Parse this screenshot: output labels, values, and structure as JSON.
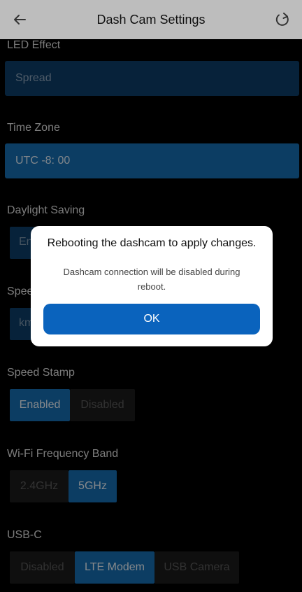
{
  "header": {
    "title": "Dash Cam Settings",
    "back_icon": "arrow-left-icon",
    "refresh_icon": "refresh-icon"
  },
  "led_effect": {
    "label": "LED Effect",
    "value": "Spread"
  },
  "time_zone": {
    "label": "Time Zone",
    "value": "UTC -8: 00"
  },
  "daylight_saving": {
    "label": "Daylight Saving",
    "partial": "En"
  },
  "speed_unit": {
    "label": "Spee",
    "partial": "km"
  },
  "speed_stamp": {
    "label": "Speed Stamp",
    "options": [
      "Enabled",
      "Disabled"
    ],
    "selected": "Enabled"
  },
  "wifi_band": {
    "label": "Wi-Fi Frequency Band",
    "options": [
      "2.4GHz",
      "5GHz"
    ],
    "selected": "5GHz"
  },
  "usb_c": {
    "label": "USB-C",
    "options": [
      "Disabled",
      "LTE Modem",
      "USB Camera"
    ],
    "selected": "LTE Modem"
  },
  "modal": {
    "title": "Rebooting the dashcam to apply changes.",
    "body": "Dashcam connection will be disabled during reboot.",
    "ok_label": "OK"
  },
  "colors": {
    "accent": "#1670b5",
    "accent_dim": "#0d3e6a",
    "ok_button": "#0a63bd",
    "header_bg": "#bdbdbd"
  }
}
